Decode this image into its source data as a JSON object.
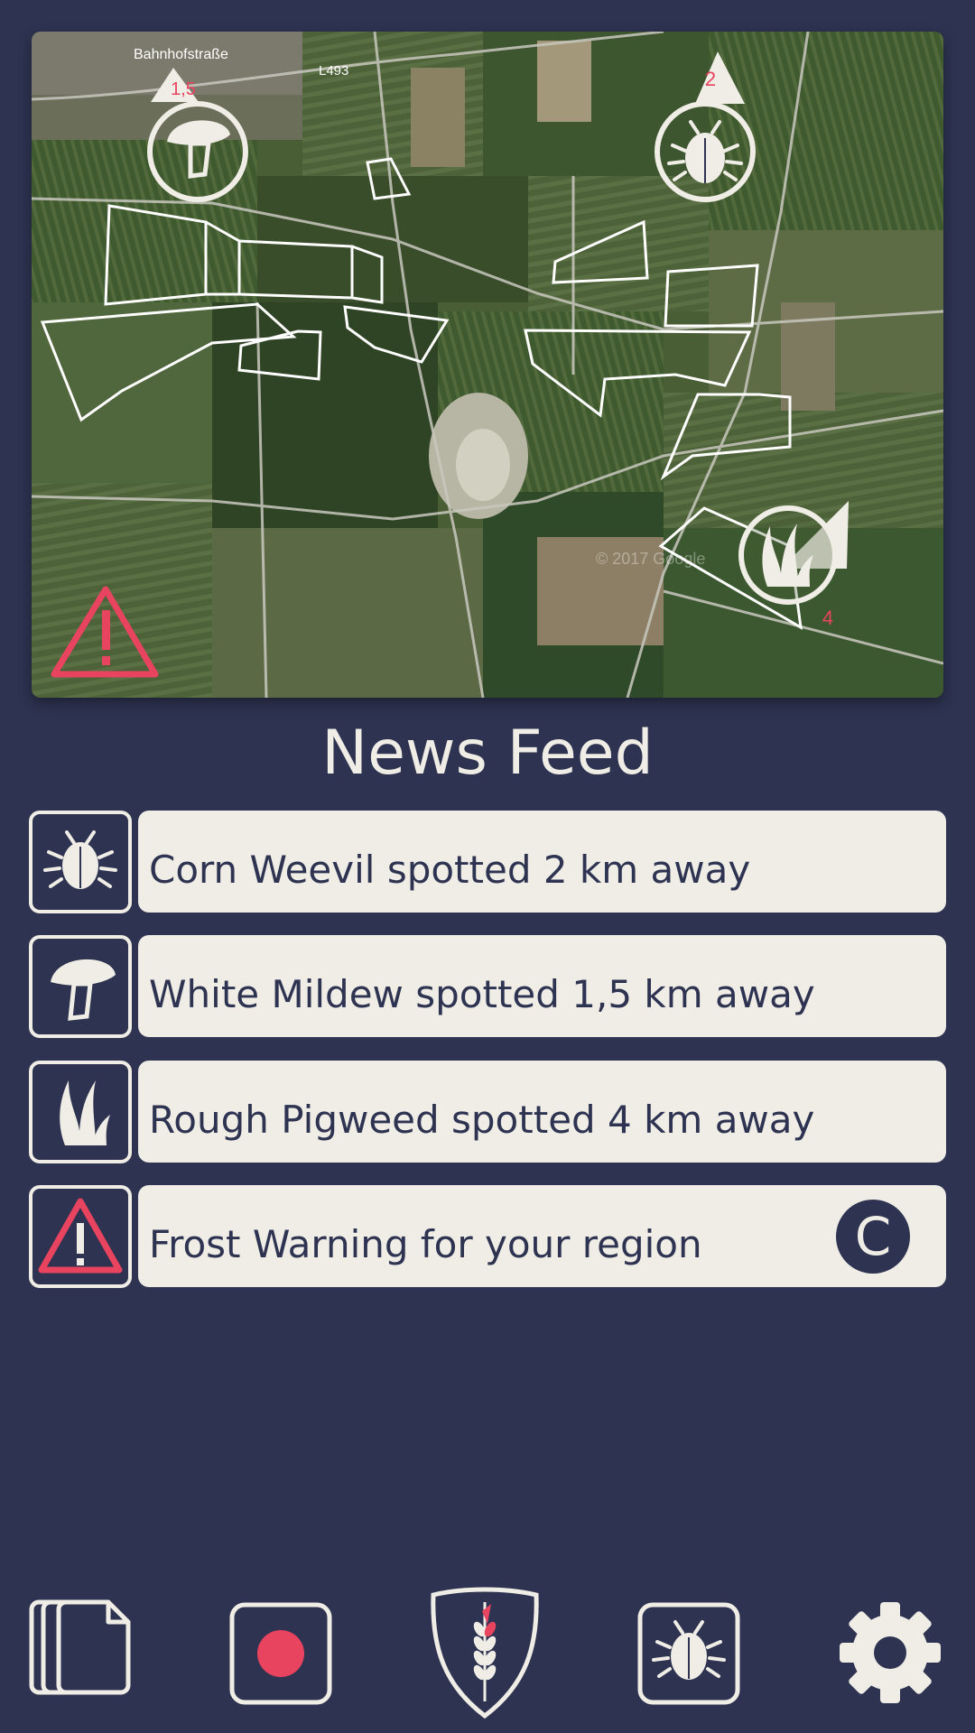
{
  "colors": {
    "background": "#2d3350",
    "card": "#efede6",
    "accent_red": "#e8435f",
    "text_dark": "#2d3350"
  },
  "map": {
    "street_label_1": "Bahnhofstraße",
    "street_label_2": "L493",
    "copyright": "© 2017 Google",
    "markers": [
      {
        "type": "fungus-icon",
        "distance": "1,5"
      },
      {
        "type": "bug-icon",
        "distance": "2"
      },
      {
        "type": "weed-icon",
        "distance": "4"
      }
    ],
    "warning_icon": "warning-icon"
  },
  "news": {
    "title": "News Feed",
    "items": [
      {
        "icon": "bug-icon",
        "text": "Corn Weevil spotted 2 km away"
      },
      {
        "icon": "fungus-icon",
        "text": "White Mildew spotted 1,5 km away"
      },
      {
        "icon": "weed-icon",
        "text": "Rough Pigweed spotted 4 km away"
      },
      {
        "icon": "warning-icon",
        "text": "Frost Warning for your region",
        "badge": "C"
      }
    ]
  },
  "bottom_nav": [
    {
      "icon": "documents-icon"
    },
    {
      "icon": "record-icon"
    },
    {
      "icon": "wheat-shield-icon"
    },
    {
      "icon": "bug-icon"
    },
    {
      "icon": "gear-icon"
    }
  ]
}
